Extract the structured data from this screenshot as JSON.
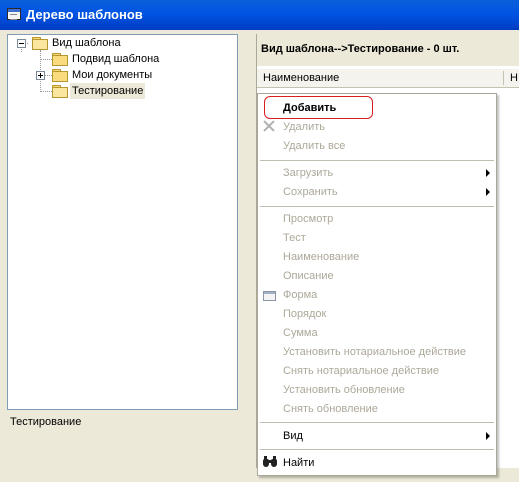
{
  "window": {
    "title": "Дерево шаблонов"
  },
  "tree": {
    "root": "Вид шаблона",
    "items": [
      {
        "label": "Подвид шаблона"
      },
      {
        "label": "Мои документы"
      },
      {
        "label": "Тестирование"
      }
    ]
  },
  "status": {
    "selected": "Тестирование"
  },
  "panel": {
    "header": "Вид шаблона-->Тестирование - 0 шт.",
    "columns": [
      "Наименование",
      "Н"
    ]
  },
  "context_menu": {
    "items": [
      {
        "label": "Добавить",
        "enabled": true,
        "highlighted": true
      },
      {
        "label": "Удалить",
        "enabled": false,
        "icon": "delete-x-icon"
      },
      {
        "label": "Удалить все",
        "enabled": false
      },
      {
        "label": "Загрузить",
        "enabled": false,
        "submenu": true
      },
      {
        "label": "Сохранить",
        "enabled": false,
        "submenu": true
      },
      {
        "label": "Просмотр",
        "enabled": false
      },
      {
        "label": "Тест",
        "enabled": false
      },
      {
        "label": "Наименование",
        "enabled": false
      },
      {
        "label": "Описание",
        "enabled": false
      },
      {
        "label": "Форма",
        "enabled": false,
        "icon": "form-window-icon"
      },
      {
        "label": "Порядок",
        "enabled": false
      },
      {
        "label": "Сумма",
        "enabled": false
      },
      {
        "label": "Установить нотариальное действие",
        "enabled": false
      },
      {
        "label": "Снять нотариальное действие",
        "enabled": false
      },
      {
        "label": "Установить обновление",
        "enabled": false
      },
      {
        "label": "Снять обновление",
        "enabled": false
      },
      {
        "label": "Вид",
        "enabled": true,
        "submenu": true
      },
      {
        "label": "Найти",
        "enabled": true,
        "icon": "binoculars-icon"
      }
    ]
  },
  "colors": {
    "titlebar": "#0054e3",
    "highlight_ring": "#d81e1e",
    "disabled_text": "#aca899"
  }
}
